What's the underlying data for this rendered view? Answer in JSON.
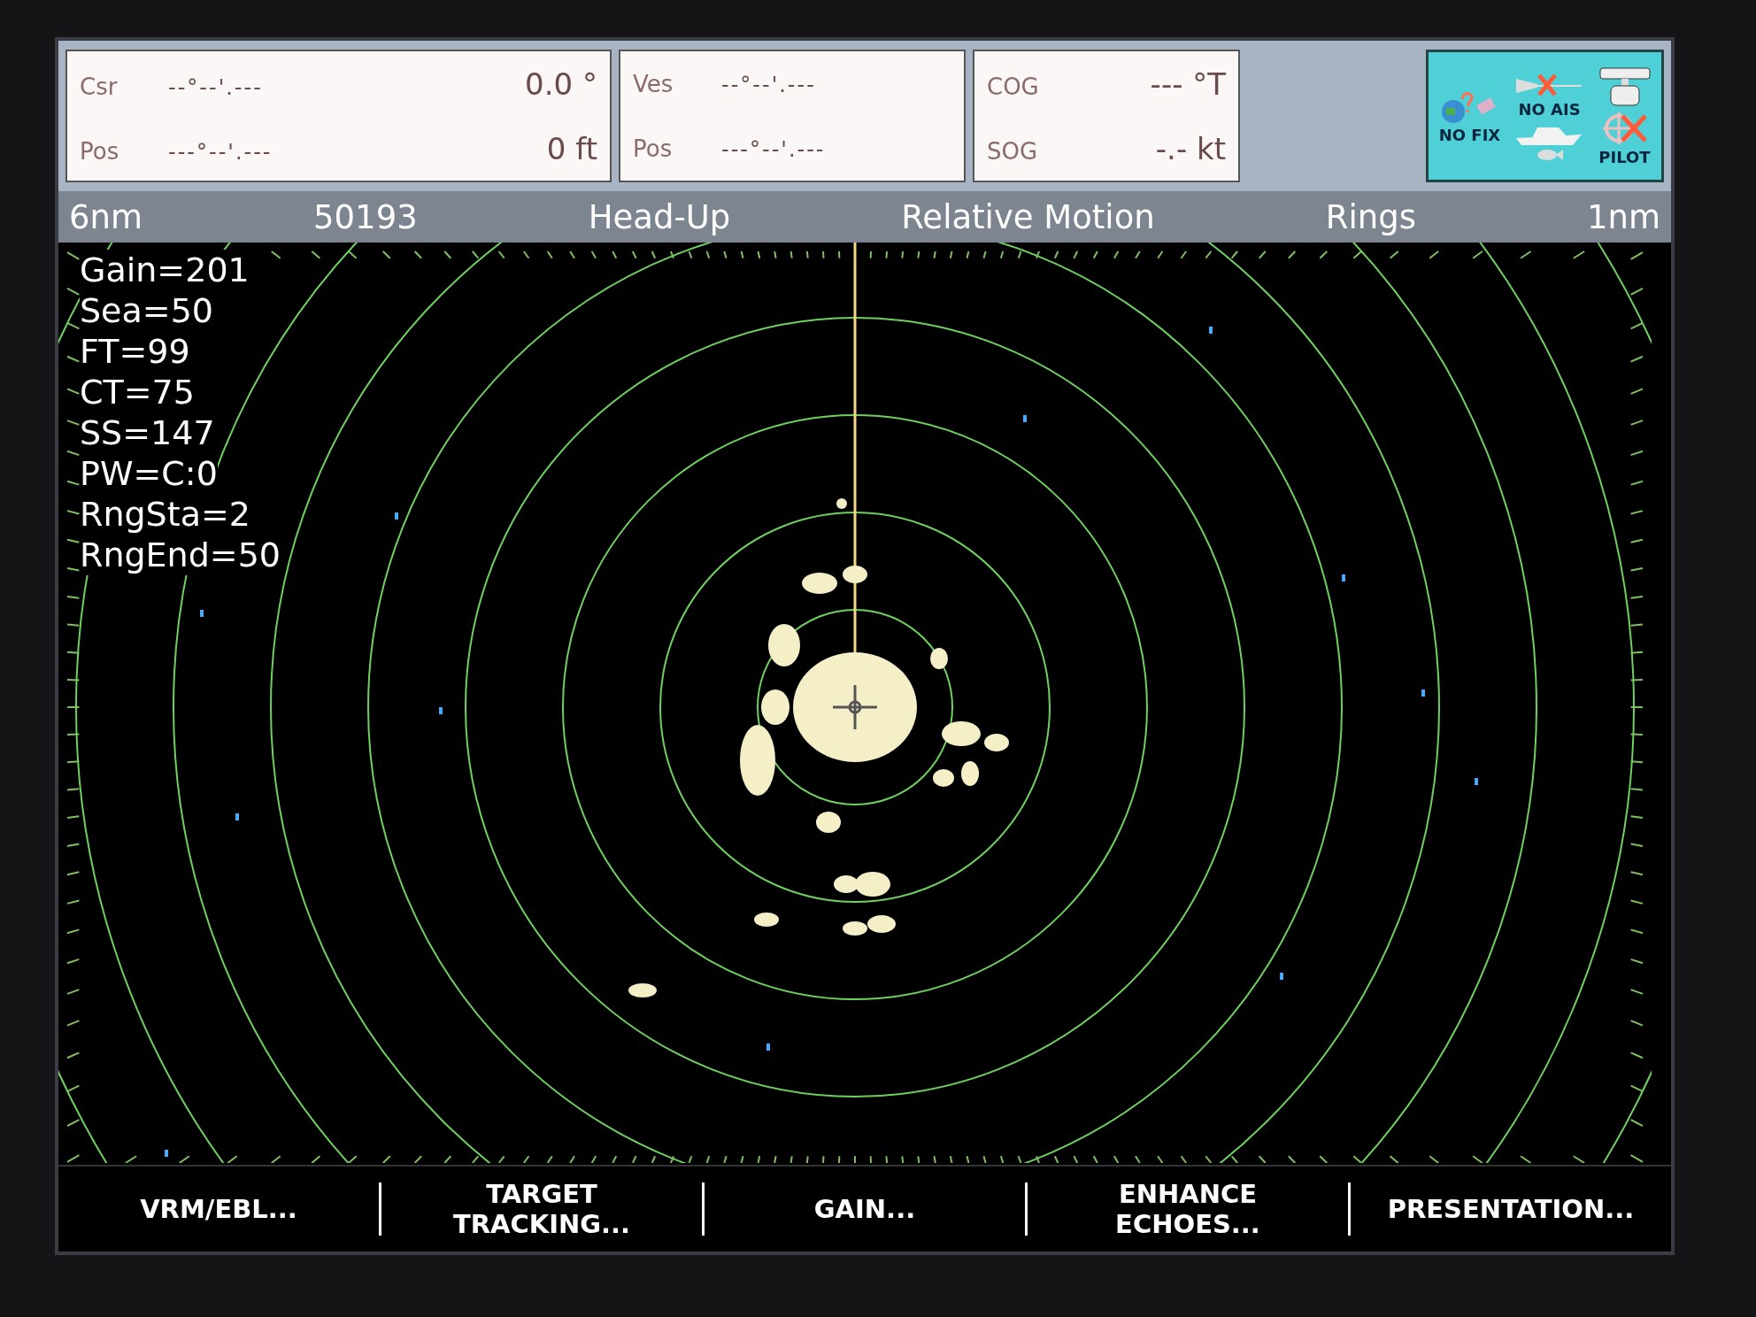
{
  "readouts": [
    {
      "boxes": [
        {
          "label": "Csr",
          "coord": "--°--'.---",
          "value": "0.0 °"
        },
        {
          "label": "Pos",
          "coord": "---°--'.---",
          "value": "0 ft"
        }
      ]
    },
    {
      "boxes": [
        {
          "label": "Ves",
          "coord": "--°--'.---"
        },
        {
          "label": "Pos",
          "coord": "---°--'.---"
        }
      ]
    },
    {
      "boxes": [
        {
          "label": "COG",
          "value": "--- °T"
        },
        {
          "label": "SOG",
          "value": "-.- kt"
        }
      ]
    }
  ],
  "status_icons": {
    "no_fix": "NO FIX",
    "no_ais": "NO AIS",
    "pilot": "PILOT"
  },
  "status_bar": {
    "range": "6nm",
    "code": "50193",
    "orientation": "Head-Up",
    "motion": "Relative Motion",
    "rings_label": "Rings",
    "rings_interval": "1nm"
  },
  "radar_settings": [
    "Gain=201",
    "Sea=50",
    "FT=99",
    "CT=75",
    "SS=147",
    "PW=C:0",
    "RngSta=2",
    "RngEnd=50"
  ],
  "softkeys": [
    [
      "VRM/EBL..."
    ],
    [
      "TARGET",
      "TRACKING..."
    ],
    [
      "GAIN..."
    ],
    [
      "ENHANCE",
      "ECHOES..."
    ],
    [
      "PRESENTATION..."
    ]
  ]
}
